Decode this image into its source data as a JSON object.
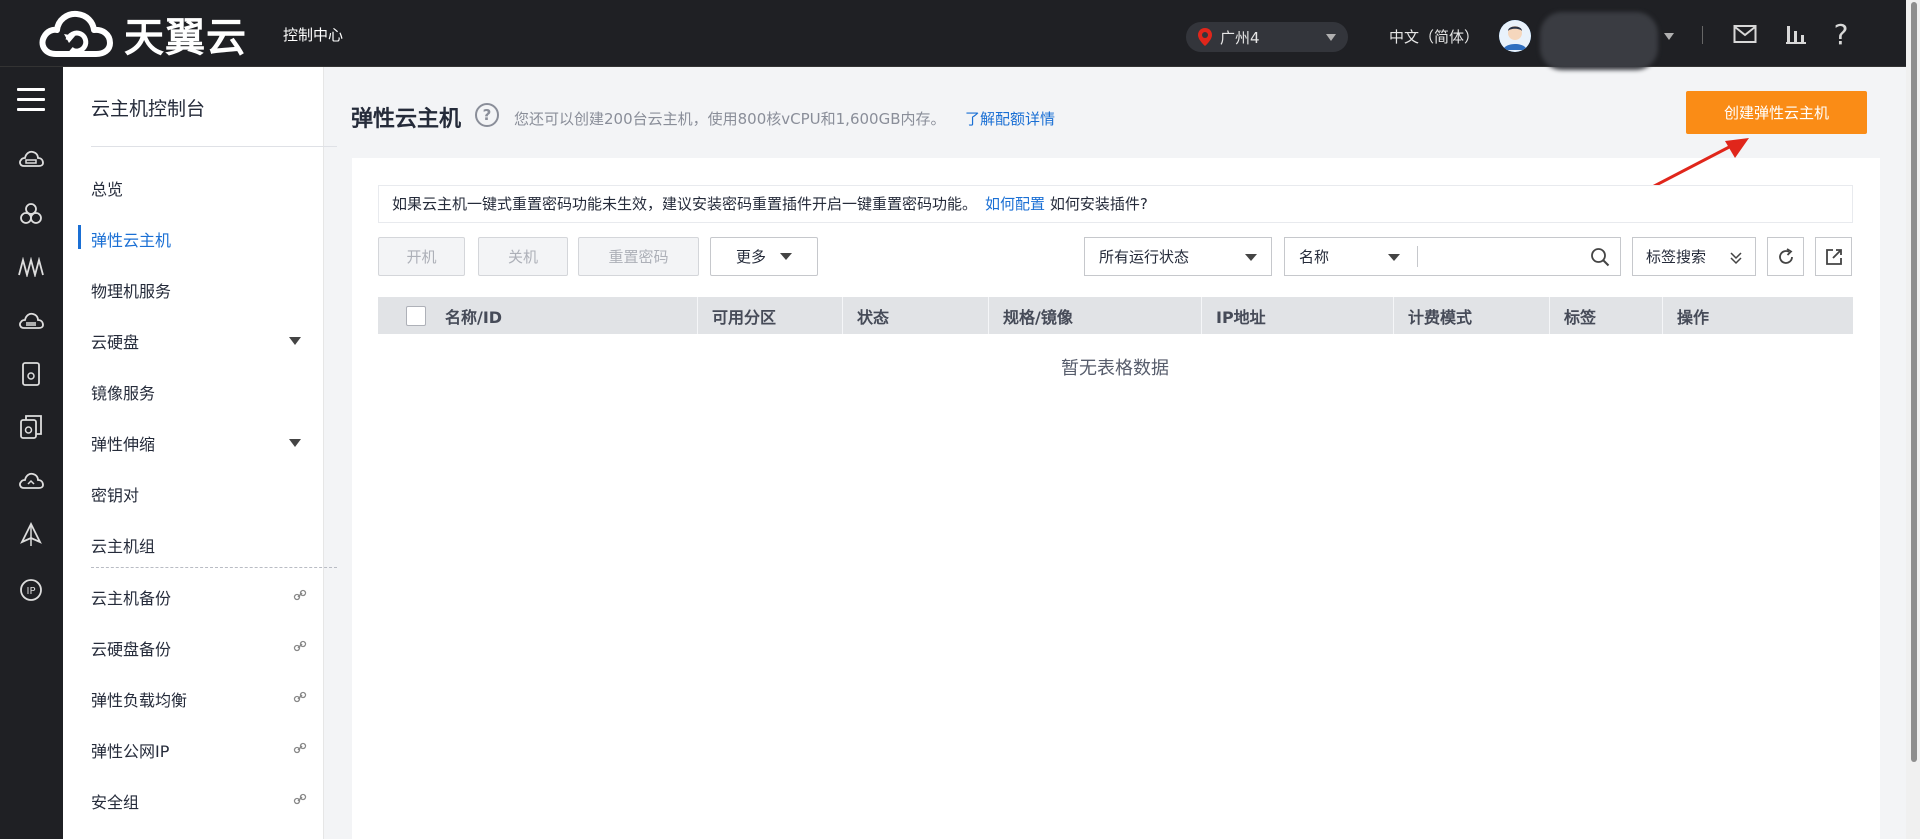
{
  "topbar": {
    "logo_text": "天翼云",
    "console_label": "控制中心",
    "region": "广州4",
    "language": "中文（简体）"
  },
  "sidemenu": {
    "title": "云主机控制台",
    "items": [
      {
        "label": "总览"
      },
      {
        "label": "弹性云主机"
      },
      {
        "label": "物理机服务"
      },
      {
        "label": "云硬盘"
      },
      {
        "label": "镜像服务"
      },
      {
        "label": "弹性伸缩"
      },
      {
        "label": "密钥对"
      },
      {
        "label": "云主机组"
      },
      {
        "label": "云主机备份"
      },
      {
        "label": "云硬盘备份"
      },
      {
        "label": "弹性负载均衡"
      },
      {
        "label": "弹性公网IP"
      },
      {
        "label": "安全组"
      }
    ]
  },
  "main": {
    "title": "弹性云主机",
    "quota_text": "您还可以创建200台云主机，使用800核vCPU和1,600GB内存。",
    "quota_link": "了解配额详情",
    "create_button": "创建弹性云主机",
    "notice_text": "如果云主机一键式重置密码功能未生效，建议安装密码重置插件开启一键重置密码功能。",
    "notice_link": "如何配置",
    "notice_tail": "如何安装插件?",
    "toolbar": {
      "start": "开机",
      "stop": "关机",
      "reset_password": "重置密码",
      "more": "更多",
      "status_filter": "所有运行状态",
      "search_field": "名称",
      "search_value": "",
      "tag_search": "标签搜索"
    },
    "table": {
      "columns": [
        "名称/ID",
        "可用分区",
        "状态",
        "规格/镜像",
        "IP地址",
        "计费模式",
        "标签",
        "操作"
      ],
      "empty_text": "暂无表格数据"
    }
  },
  "colors": {
    "topbar_bg": "#1f2024",
    "accent_blue": "#1a6fd4",
    "create_orange": "#fa8c16",
    "annotation_red": "#e0261b"
  }
}
